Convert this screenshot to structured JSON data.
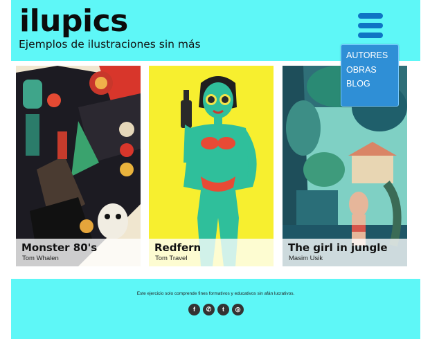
{
  "site": {
    "logo": "ilupics",
    "tagline": "Ejemplos de ilustraciones sin más"
  },
  "menu": {
    "items": [
      {
        "label": "AUTORES"
      },
      {
        "label": "OBRAS"
      },
      {
        "label": "BLOG"
      }
    ]
  },
  "cards": [
    {
      "title": "Monster 80's",
      "author": "Tom Whalen"
    },
    {
      "title": "Redfern",
      "author": "Tom Travel"
    },
    {
      "title": "The girl in jungle",
      "author": "Masim Usik"
    }
  ],
  "footer": {
    "text": "Este ejercicio solo comprende fines formativos y educativos sin afán  lucrativos.",
    "social": [
      {
        "icon": "facebook-icon",
        "glyph": "f"
      },
      {
        "icon": "whatsapp-icon",
        "glyph": "✆"
      },
      {
        "icon": "twitter-icon",
        "glyph": "t"
      },
      {
        "icon": "instagram-icon",
        "glyph": "◎"
      }
    ]
  },
  "colors": {
    "header_bg": "#5ef7f7",
    "menu_bg": "#2f8fd6",
    "hamburger": "#0f74c4"
  }
}
